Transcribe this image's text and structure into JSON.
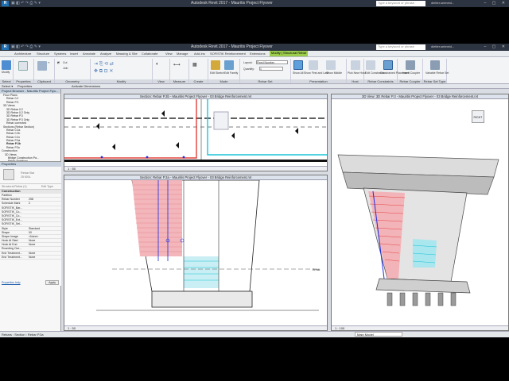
{
  "app": {
    "title": "Autodesk Revit 2017 -    Mauritis Project Flyover",
    "search_placeholder": "Type a keyword or phrase",
    "user": "dietter.seimeid...",
    "logo": "R"
  },
  "tabs": [
    "Architecture",
    "Structure",
    "Systems",
    "Insert",
    "Annotate",
    "Analyze",
    "Massing & Site",
    "Collaborate",
    "View",
    "Manage",
    "Add-Ins",
    "SOFiSTiK Reinforcement",
    "Extensions",
    "Modify | Structural Rebar"
  ],
  "ribbon": {
    "groups": [
      "Select",
      "Properties",
      "Clipboard",
      "Geometry",
      "Modify",
      "View",
      "Measure",
      "Create",
      "Mode",
      "Rebar Set",
      "Presentation",
      "Host",
      "Rebar Constraints",
      "Rebar Coupler",
      "Rebar Set Type"
    ],
    "layout_label": "Layout:",
    "layout_value": "Fixed Number",
    "quantity_label": "Quantity:",
    "quantity_value": "1",
    "btn_show_all": "Show All",
    "btn_show_first_last": "Show First and Last",
    "btn_show_middle": "Show Middle",
    "btn_constrained_placement": "Constrained Placement",
    "btn_insert_coupler": "Insert Coupler",
    "btn_variable_rebar_set": "Variable Rebar Set",
    "btn_cut": "Cut",
    "btn_join": "Join",
    "btn_modify": "Modify",
    "btn_edit_sketch": "Edit Sketch",
    "btn_edit_family": "Edit Family",
    "btn_edit_constraints": "Edit Constraints",
    "btn_pick_new_host": "Pick New Host"
  },
  "optbar": {
    "select_label": "Select ▾",
    "properties_label": "Properties",
    "activate_label": "Activate Dimensions"
  },
  "project_browser": {
    "title": "Project Browser - Mauritis Project Flyo...",
    "items": [
      "Floor Plans",
      "Rebar 0.2",
      "Rebar P.3",
      "3D Views",
      "3D Rebar 0.2",
      "3D Rebar 0.2 Only",
      "3D Rebar P.3",
      "3D Rebar P.3 Only",
      "Rebar corrected",
      "Sections (Rebar Section)",
      "Rebar 0.2a",
      "Rebar 0.2b",
      "Rebar 0.2c",
      "Rebar P.3a",
      "Rebar P.3b",
      "Rebar P.3c",
      "Construction",
      "3D Views",
      "Bridge Construction Pa...",
      "Rebar Partitions",
      "Visualization",
      "Legends",
      "Schedules/Quantities",
      "Sheets (all)"
    ]
  },
  "properties": {
    "title": "Properties",
    "type_name": "Rebar Bar",
    "type_sub": "25 600L",
    "selector": "Structural Rebar (1)",
    "edit_type": "Edit Type",
    "section": "Construction",
    "rows": [
      [
        "Partition",
        ""
      ],
      [
        "Rebar Number",
        "258"
      ],
      [
        "Schedule Mark",
        "2"
      ],
      [
        "SOFISTIK_Bar...",
        ""
      ],
      [
        "SOFISTIK_Co...",
        ""
      ],
      [
        "SOFISTIK_Co...",
        ""
      ],
      [
        "SOFISTIK_Ext...",
        ""
      ],
      [
        "SOFISTIK_Sel...",
        ""
      ],
      [
        "Style",
        "Standard"
      ],
      [
        "Shape",
        "00"
      ],
      [
        "Shape Image",
        "<None>"
      ],
      [
        "Hook At Start",
        "None"
      ],
      [
        "Hook At End",
        "None"
      ],
      [
        "Rounding Ove...",
        ""
      ],
      [
        "End Treatment...",
        "None"
      ],
      [
        "End Treatment...",
        "None"
      ]
    ],
    "help_link": "Properties help",
    "apply": "Apply"
  },
  "views": {
    "top_section": {
      "title": "Section: Rebar P.3b - Mauritis Project Flyover - 03 Bridge Reinforcement.rvt",
      "scale": "1 : 50"
    },
    "bottom_section": {
      "title": "Section: Rebar P.3a - Mauritis Project Flyover - 03 Bridge Reinforcement.rvt",
      "scale": "1 : 50"
    },
    "view_3d": {
      "title": "3D View: 3D Rebar P.3 - Mauritis Project Flyover - 03 Bridge Reinforcement.rvt",
      "scale": "1 : 100",
      "viewcube": "RIGHT"
    }
  },
  "annotation_right": "Ermitt",
  "statusbar": {
    "text": "Rebars : Section : Rebar P.3a",
    "model": "Main Model"
  },
  "colors": {
    "rebar_red": "#e2403c",
    "rebar_blue": "#1e2de0",
    "rebar_cyan": "#18c6d8",
    "ribbon_active": "#9ccc4c",
    "bar_hatch": "#e78a8f"
  }
}
